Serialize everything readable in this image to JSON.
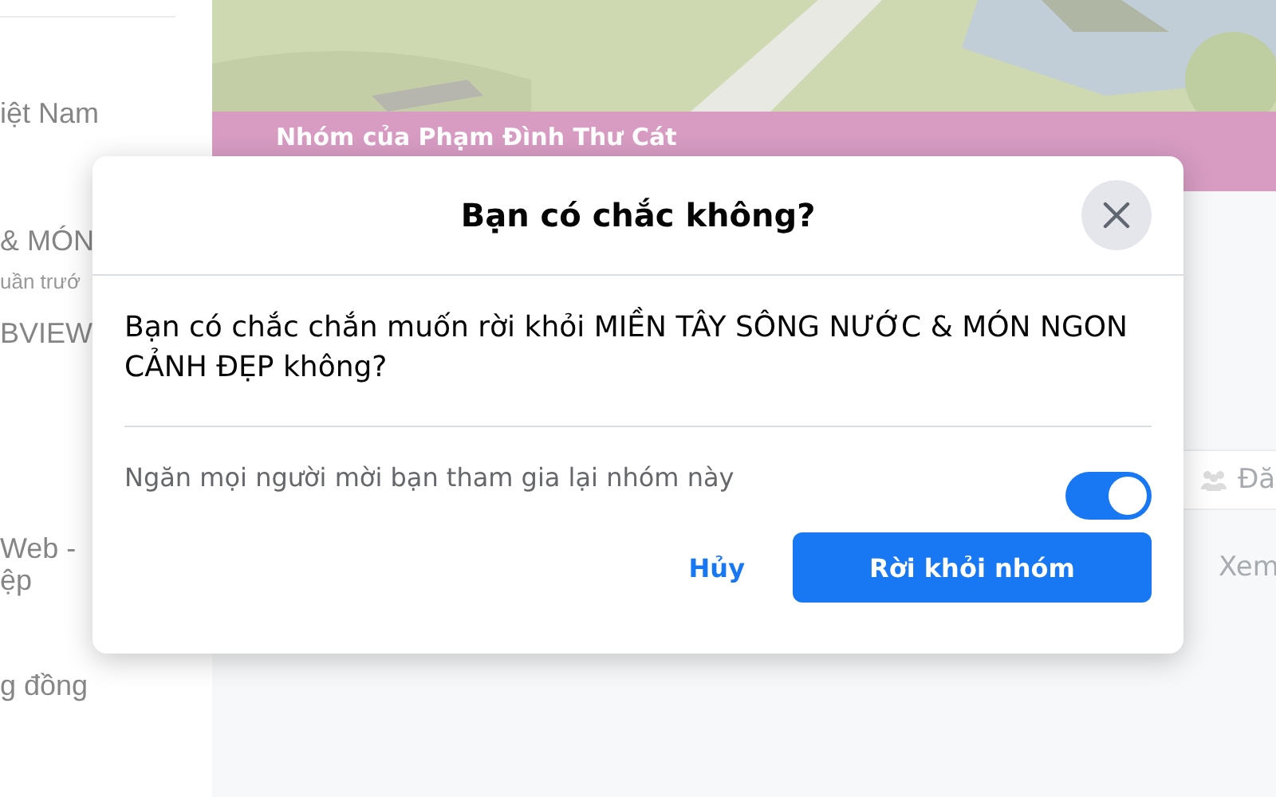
{
  "background": {
    "sidebar_items": [
      {
        "text": "iệt Nam",
        "kind": "title"
      },
      {
        "text": "& MÓN",
        "kind": "title"
      },
      {
        "text": "uần trướ",
        "kind": "meta"
      },
      {
        "text": "BVIEW",
        "kind": "title"
      },
      {
        "text": "Web -",
        "kind": "title"
      },
      {
        "text": "ệp",
        "kind": "title"
      },
      {
        "text": "g đồng",
        "kind": "title"
      }
    ],
    "group_owner": "Nhóm của Phạm Đình Thư Cát",
    "members_label": "Đă",
    "see_label": "Xem"
  },
  "dialog": {
    "title": "Bạn có chắc không?",
    "message": "Bạn có chắc chắn muốn rời khỏi MIỀN TÂY SÔNG NƯỚC & MÓN NGON CẢNH ĐẸP không?",
    "option": {
      "label": "Ngăn mọi người mời bạn tham gia lại nhóm này",
      "on": true
    },
    "buttons": [
      {
        "label": "Hủy",
        "kind": "link"
      },
      {
        "label": "Rời khỏi nhóm",
        "kind": "primary"
      }
    ]
  }
}
